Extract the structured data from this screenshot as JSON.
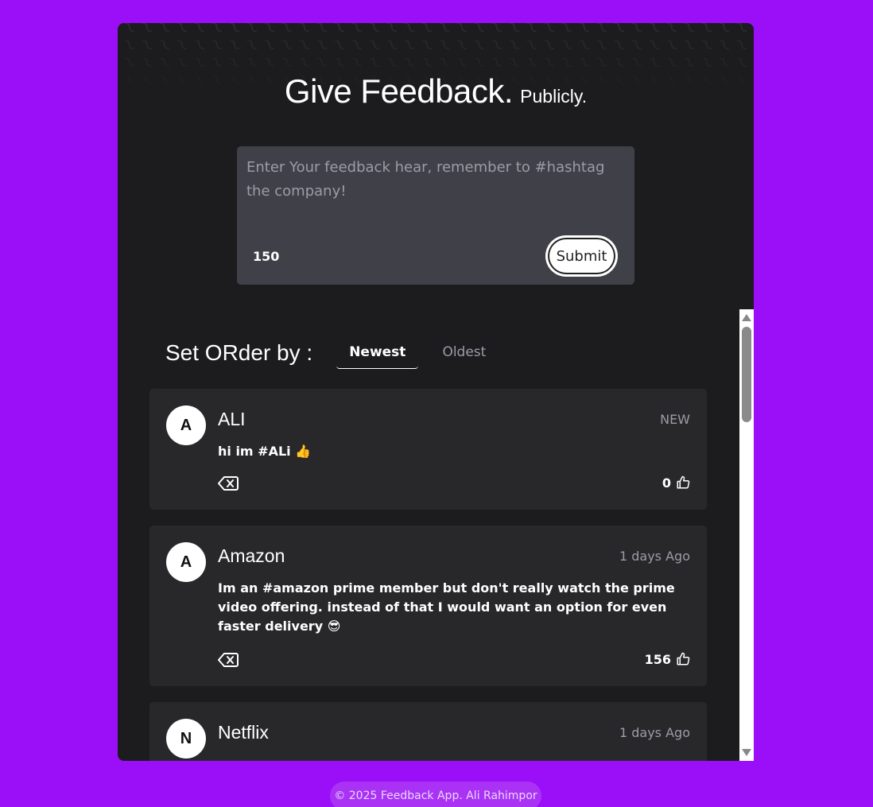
{
  "header": {
    "title": "Give Feedback.",
    "subtitle": "Publicly."
  },
  "form": {
    "placeholder": "Enter Your feedback hear, remember to #hashtag the company!",
    "counter": "150",
    "submit_label": "Submit"
  },
  "sort": {
    "label": "Set ORder by :",
    "tabs": [
      "Newest",
      "Oldest"
    ],
    "active": "Newest"
  },
  "feedback": [
    {
      "initial": "A",
      "company": "ALI",
      "meta": "NEW",
      "text": "hi im #ALi 👍",
      "likes": "0"
    },
    {
      "initial": "A",
      "company": "Amazon",
      "meta": "1 days Ago",
      "text": "Im an #amazon prime member but don't really watch the prime video offering. instead of that I would want an option for even faster delivery 😎",
      "likes": "156"
    },
    {
      "initial": "N",
      "company": "Netflix",
      "meta": "1 days Ago",
      "text": "",
      "likes": ""
    }
  ],
  "footer": {
    "text": "© 2025 Feedback App. Ali Rahimpor"
  },
  "icons": {
    "delete": "backspace-icon",
    "like": "thumbs-up-icon"
  },
  "colors": {
    "page_background": "#9a0ff8",
    "panel": "#1c1c1e",
    "card": "#28282b",
    "input": "#404049"
  }
}
